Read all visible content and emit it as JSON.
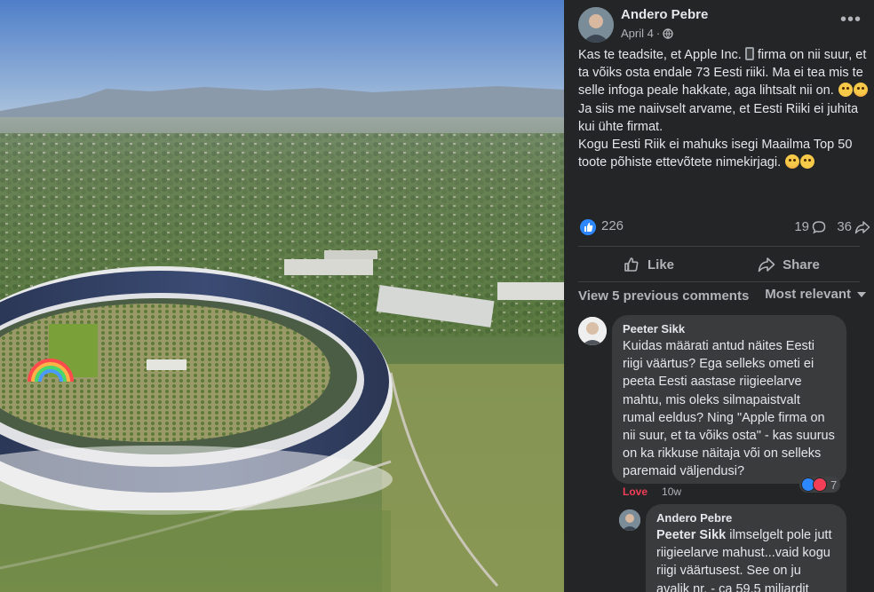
{
  "post": {
    "author": "Andero Pebre",
    "date": "April 4",
    "date_sep": "·",
    "privacy_icon": "globe-icon",
    "text": {
      "p1_a": "Kas te teadsite, et Apple Inc. ",
      "p1_b": " firma on nii suur, et ta võiks osta endale 73 Eesti riiki. Ma ei tea mis te selle infoga peale hakkate, aga lihtsalt nii on. ",
      "p2": "Ja siis me naiivselt arvame, et Eesti Riiki ei juhita kui ühte firmat.",
      "p3": "Kogu Eesti Riik ei mahuks isegi Maailma Top 50 toote põhiste ettevõtete nimekirjagi. "
    },
    "reaction_count": "226",
    "comment_count": "19",
    "share_count": "36"
  },
  "actions": {
    "like": "Like",
    "share": "Share"
  },
  "comments_section": {
    "view_previous": "View 5 previous comments",
    "sort": "Most relevant"
  },
  "comments": [
    {
      "author": "Peeter Sikk",
      "text": "Kuidas määrati antud näites Eesti riigi väärtus? Ega selleks ometi ei peeta Eesti aastase riigieelarve mahtu, mis oleks silmapaistvalt rumal eeldus? Ning \"Apple firma on nii suur, et ta võiks osta\" - kas suurus on ka rikkuse näitaja või on selleks paremaid väljendusi?",
      "reaction_count": "7",
      "reaction_label": "Love",
      "time": "10w"
    }
  ],
  "replies": [
    {
      "author": "Andero Pebre",
      "mention": "Peeter Sikk",
      "text": " ilmselgelt pole jutt riigieelarve mahust...vaid kogu riigi väärtusest. See on ju avalik nr. - ca 59.5 miljardit"
    }
  ],
  "colors": {
    "accent": "#2d88ff",
    "love": "#f33e58",
    "panel": "#242526",
    "bubble": "#3a3b3c"
  }
}
